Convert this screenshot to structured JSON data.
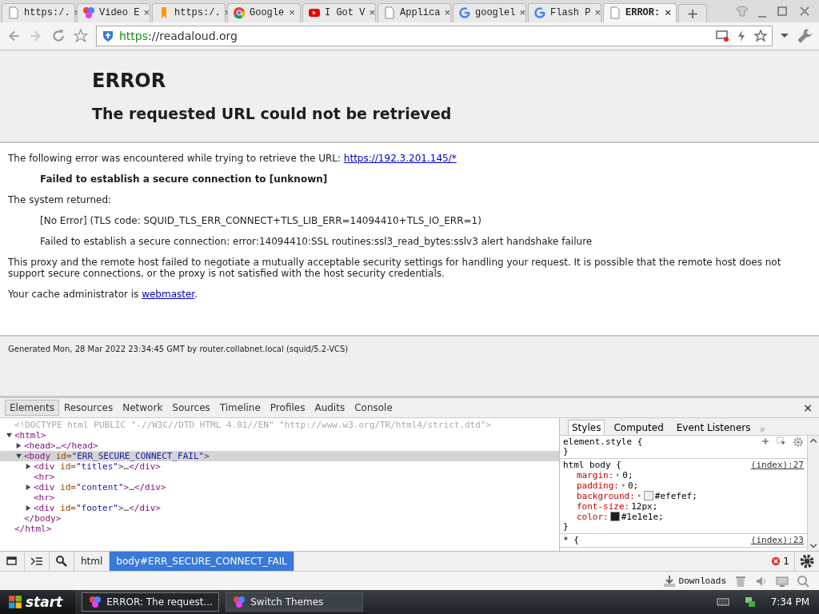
{
  "browser": {
    "tabs": [
      {
        "label": "https:/.",
        "kind": "page",
        "close": "×",
        "selected": false
      },
      {
        "label": "Video E",
        "kind": "pinwheel",
        "close": "×",
        "selected": false
      },
      {
        "label": "https:/.",
        "kind": "blog",
        "close": "×",
        "selected": false
      },
      {
        "label": "Google",
        "kind": "chrome",
        "close": "×",
        "selected": false
      },
      {
        "label": "I Got V",
        "kind": "youtube",
        "close": "×",
        "selected": false
      },
      {
        "label": "Applica",
        "kind": "page",
        "close": "×",
        "selected": false
      },
      {
        "label": "googlel",
        "kind": "google",
        "close": "×",
        "selected": false
      },
      {
        "label": "Flash P",
        "kind": "google",
        "close": "×",
        "selected": false
      },
      {
        "label": "ERROR:",
        "kind": "page",
        "close": "×",
        "selected": true
      }
    ],
    "new_tab": "+",
    "address_bar": {
      "scheme": "https",
      "rest": "://readaloud.org"
    }
  },
  "page": {
    "title": "ERROR",
    "subtitle": "The requested URL could not be retrieved",
    "content": [
      {
        "kind": "text",
        "text": "The following error was encountered while trying to retrieve the URL: ",
        "link": "https://192.3.201.145/*"
      },
      {
        "kind": "bold",
        "text": "Failed to establish a secure connection to [unknown]"
      },
      {
        "kind": "text",
        "text": "The system returned:"
      },
      {
        "kind": "indent",
        "text": "[No Error] (TLS code: SQUID_TLS_ERR_CONNECT+TLS_LIB_ERR=14094410+TLS_IO_ERR=1)"
      },
      {
        "kind": "indent",
        "text": "Failed to establish a secure connection: error:14094410:SSL routines:ssl3_read_bytes:sslv3 alert handshake failure"
      },
      {
        "kind": "text",
        "text": "This proxy and the remote host failed to negotiate a mutually acceptable security settings for handling your request. It is possible that the remote host does not support secure connections, or the proxy is not satisfied with the host security credentials."
      },
      {
        "kind": "text",
        "text": "Your cache administrator is ",
        "link": "webmaster",
        "after": "."
      }
    ],
    "footer": "Generated Mon, 28 Mar 2022 23:34:45 GMT by router.collabnet.local (squid/5.2-VCS)"
  },
  "devtools": {
    "tabs": [
      {
        "label": "Elements",
        "selected": true
      },
      {
        "label": "Resources",
        "selected": false
      },
      {
        "label": "Network",
        "selected": false
      },
      {
        "label": "Sources",
        "selected": false
      },
      {
        "label": "Timeline",
        "selected": false
      },
      {
        "label": "Profiles",
        "selected": false
      },
      {
        "label": "Audits",
        "selected": false
      },
      {
        "label": "Console",
        "selected": false
      }
    ],
    "close": "×",
    "dom": [
      {
        "segments": [
          {
            "kind": "comment",
            "t": "<!DOCTYPE html PUBLIC \"-//W3C//DTD HTML 4.01//EN\" \"http://www.w3.org/TR/html4/strict.dtd\">"
          }
        ]
      },
      {
        "segments": [
          {
            "kind": "tag",
            "t": "<html>"
          }
        ],
        "expanded": true,
        "selected": false,
        "close": "</html>",
        "children": [
          {
            "segments": [
              {
                "kind": "tag",
                "t": "<head>"
              },
              {
                "kind": "text",
                "t": "…"
              },
              {
                "kind": "tag",
                "t": "</head>"
              }
            ],
            "expanded": false,
            "selected": false
          },
          {
            "segments": [
              {
                "kind": "tag",
                "t": "<body "
              },
              {
                "kind": "attr",
                "t": "id="
              },
              {
                "kind": "value",
                "t": "\"ERR_SECURE_CONNECT_FAIL\""
              },
              {
                "kind": "tag",
                "t": ">"
              }
            ],
            "expanded": true,
            "selected": true,
            "close": "</body>",
            "children": [
              {
                "segments": [
                  {
                    "kind": "tag",
                    "t": "<div "
                  },
                  {
                    "kind": "attr",
                    "t": "id="
                  },
                  {
                    "kind": "value",
                    "t": "\"titles\""
                  },
                  {
                    "kind": "tag",
                    "t": ">"
                  },
                  {
                    "kind": "text",
                    "t": "…"
                  },
                  {
                    "kind": "tag",
                    "t": "</div>"
                  }
                ],
                "expanded": false,
                "selected": false
              },
              {
                "segments": [
                  {
                    "kind": "tag",
                    "t": "<hr>"
                  }
                ]
              },
              {
                "segments": [
                  {
                    "kind": "tag",
                    "t": "<div "
                  },
                  {
                    "kind": "attr",
                    "t": "id="
                  },
                  {
                    "kind": "value",
                    "t": "\"content\""
                  },
                  {
                    "kind": "tag",
                    "t": ">"
                  },
                  {
                    "kind": "text",
                    "t": "…"
                  },
                  {
                    "kind": "tag",
                    "t": "</div>"
                  }
                ],
                "expanded": false,
                "selected": false
              },
              {
                "segments": [
                  {
                    "kind": "tag",
                    "t": "<hr>"
                  }
                ]
              },
              {
                "segments": [
                  {
                    "kind": "tag",
                    "t": "<div "
                  },
                  {
                    "kind": "attr",
                    "t": "id="
                  },
                  {
                    "kind": "value",
                    "t": "\"footer\""
                  },
                  {
                    "kind": "tag",
                    "t": ">"
                  },
                  {
                    "kind": "text",
                    "t": "…"
                  },
                  {
                    "kind": "tag",
                    "t": "</div>"
                  }
                ],
                "expanded": false,
                "selected": false
              }
            ]
          }
        ]
      }
    ],
    "side_tabs": [
      {
        "label": "Styles",
        "selected": true
      },
      {
        "label": "Computed",
        "selected": false
      },
      {
        "label": "Event Listeners",
        "selected": false
      }
    ],
    "side_more": "»",
    "rules": [
      {
        "selector": "element.style {",
        "tools": true,
        "close": "}"
      },
      {
        "selector": "html body {",
        "source": "(index):27",
        "props": [
          {
            "name": "margin:",
            "value": "0;",
            "expandable": true
          },
          {
            "name": "padding:",
            "value": "0;",
            "expandable": true
          },
          {
            "name": "background:",
            "value": "#efefef;",
            "expandable": true,
            "color": "#efefef"
          },
          {
            "name": "font-size:",
            "value": "12px;",
            "expandable": false
          },
          {
            "name": "color:",
            "value": "#1e1e1e;",
            "expandable": false,
            "color": "#1e1e1e"
          }
        ],
        "close": "}"
      },
      {
        "selector": "* {",
        "source": "(index):23"
      }
    ],
    "breadcrumbs": [
      {
        "label": "html",
        "selected": false
      },
      {
        "label": "body#ERR_SECURE_CONNECT_FAIL",
        "selected": true
      }
    ],
    "error_count": "1"
  },
  "downloads": "Downloads",
  "taskbar": {
    "start": "start",
    "windows": [
      {
        "label": "ERROR: The request...",
        "selected": true
      },
      {
        "label": "Switch Themes",
        "selected": false
      }
    ],
    "clock": "7:34 PM"
  }
}
